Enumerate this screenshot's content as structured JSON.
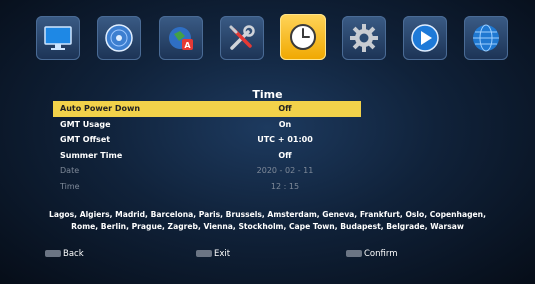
{
  "top_menu": {
    "items": [
      {
        "name": "monitor-icon"
      },
      {
        "name": "disc-icon"
      },
      {
        "name": "apps-icon"
      },
      {
        "name": "tools-icon"
      },
      {
        "name": "clock-icon",
        "active": true
      },
      {
        "name": "gear-icon"
      },
      {
        "name": "play-icon"
      },
      {
        "name": "globe-icon"
      }
    ],
    "active_color": "#f5b800",
    "tile_color": "#2a4a72"
  },
  "menu": {
    "title": "Time",
    "rows": [
      {
        "label": "Auto Power Down",
        "value": "Off",
        "selected": true
      },
      {
        "label": "GMT Usage",
        "value": "On"
      },
      {
        "label": "GMT Offset",
        "value": "UTC + 01:00"
      },
      {
        "label": "Summer Time",
        "value": "Off"
      },
      {
        "label": "Date",
        "value": "2020 - 02 - 11",
        "disabled": true
      },
      {
        "label": "Time",
        "value": "12 : 15",
        "disabled": true
      }
    ],
    "highlight_color": "#f2d24a"
  },
  "city_info": {
    "line1": "Lagos, Algiers, Madrid, Barcelona, Paris, Brussels, Amsterdam, Geneva, Frankfurt, Oslo, Copenhagen,",
    "line2": "Rome, Berlin, Prague, Zagreb, Vienna, Stockholm, Cape Town, Budapest, Belgrade, Warsaw"
  },
  "hints": {
    "back": "Back",
    "exit": "Exit",
    "confirm": "Confirm"
  }
}
